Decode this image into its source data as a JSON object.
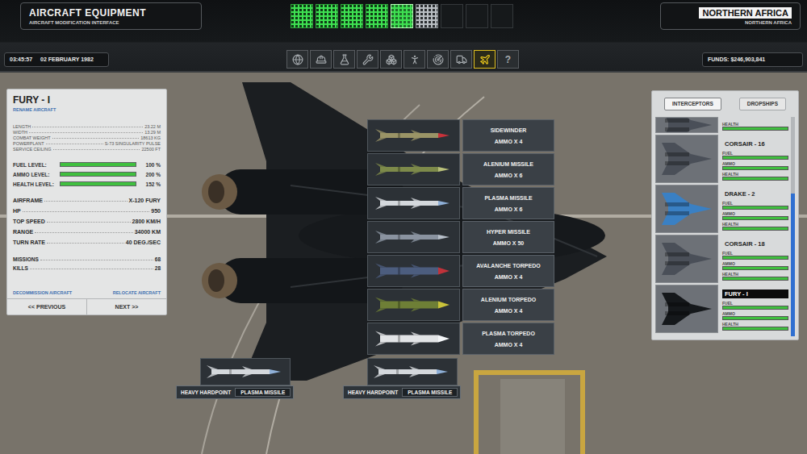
{
  "header": {
    "title": "AIRCRAFT EQUIPMENT",
    "subtitle": "AIRCRAFT MODIFICATION INTERFACE",
    "region_title": "NORTHERN AFRICA",
    "region_subtitle": "NORTHERN AFRICA",
    "time": "03:45:57",
    "date": "02 FEBRUARY 1982",
    "funds": "FUNDS: $246,903,841"
  },
  "speed_slots": [
    {
      "kind": "lit",
      "selected": false
    },
    {
      "kind": "lit",
      "selected": false
    },
    {
      "kind": "lit",
      "selected": false
    },
    {
      "kind": "lit",
      "selected": false
    },
    {
      "kind": "lit",
      "selected": true
    },
    {
      "kind": "dim",
      "selected": false
    },
    {
      "kind": "empty",
      "selected": false
    },
    {
      "kind": "empty",
      "selected": false
    },
    {
      "kind": "empty",
      "selected": false
    }
  ],
  "toolbar": [
    {
      "selected": false
    },
    {
      "selected": false
    },
    {
      "selected": false
    },
    {
      "selected": false
    },
    {
      "selected": false
    },
    {
      "selected": false
    },
    {
      "selected": false
    },
    {
      "selected": false
    },
    {
      "selected": true
    },
    {
      "glyph": "?",
      "selected": false
    }
  ],
  "aircraft": {
    "name": "FURY - I",
    "rename": "RENAME AIRCRAFT",
    "specs": [
      {
        "label": "LENGTH",
        "value": "23.22 M"
      },
      {
        "label": "WIDTH",
        "value": "13.29 M"
      },
      {
        "label": "COMBAT WEIGHT",
        "value": "18613 KG"
      },
      {
        "label": "POWERPLANT",
        "value": "S-73 SINGULARITY PULSE"
      },
      {
        "label": "SERVICE CEILING",
        "value": "22500 FT"
      }
    ],
    "levels": [
      {
        "label": "FUEL LEVEL:",
        "reading": "100 %",
        "level": 1
      },
      {
        "label": "AMMO LEVEL:",
        "reading": "200 %",
        "level": 1
      },
      {
        "label": "HEALTH LEVEL:",
        "reading": "152 %",
        "level": 1
      }
    ],
    "stats": [
      {
        "label": "AIRFRAME",
        "value": "X-120 FURY"
      },
      {
        "label": "HP",
        "value": "950"
      },
      {
        "label": "TOP SPEED",
        "value": "2800 KM/H"
      },
      {
        "label": "RANGE",
        "value": "34000 KM"
      },
      {
        "label": "TURN RATE",
        "value": "40 DEG./SEC"
      }
    ],
    "record": [
      {
        "label": "MISSIONS",
        "value": "68"
      },
      {
        "label": "KILLS",
        "value": "28"
      }
    ],
    "actions": [
      "DECOMMISSION AIRCRAFT",
      "RELOCATE AIRCRAFT"
    ],
    "nav": [
      "<< PREVIOUS",
      "NEXT >>"
    ]
  },
  "weapons": [
    {
      "name": "SIDEWINDER",
      "ammo": "AMMO X 4",
      "kind": "missile",
      "color": "#9a9466",
      "tip_color": "#c8323a"
    },
    {
      "name": "ALENIUM MISSILE",
      "ammo": "AMMO X 6",
      "kind": "missile",
      "color": "#7d8a4a",
      "tip_color": "#b9c07a"
    },
    {
      "name": "PLASMA MISSILE",
      "ammo": "AMMO X 6",
      "kind": "missile",
      "color": "#d4d8dc",
      "tip_color": "#8fb0d8"
    },
    {
      "name": "HYPER MISSILE",
      "ammo": "AMMO X 50",
      "kind": "missile",
      "color": "#8a93a0",
      "tip_color": "#b8c0ca"
    },
    {
      "name": "AVALANCHE TORPEDO",
      "ammo": "AMMO X 4",
      "kind": "torpedo",
      "color": "#4c5d7e",
      "tip_color": "#c0323a"
    },
    {
      "name": "ALENIUM TORPEDO",
      "ammo": "AMMO X 4",
      "kind": "torpedo",
      "color": "#6e7f36",
      "tip_color": "#c9c23a"
    },
    {
      "name": "PLASMA TORPEDO",
      "ammo": "AMMO X 4",
      "kind": "torpedo",
      "color": "#e2e4e6",
      "tip_color": "#f4f6f8"
    }
  ],
  "hardpoints": [
    {
      "label": "HEAVY HARDPOINT",
      "weapon": "PLASMA MISSILE",
      "color": "#d4d8dc",
      "tip_color": "#8fb0d8"
    },
    {
      "label": "HEAVY HARDPOINT",
      "weapon": "PLASMA MISSILE",
      "color": "#d4d8dc",
      "tip_color": "#8fb0d8"
    }
  ],
  "hangar": {
    "tabs": [
      {
        "label": "INTERCEPTORS",
        "selected": true
      },
      {
        "label": "DROPSHIPS",
        "selected": false
      }
    ],
    "scroll_level": 1,
    "craft": [
      {
        "kind": "partial",
        "name": "",
        "selected": false,
        "color": "#4a4f58",
        "bars": [
          {
            "label": "HEALTH",
            "level": 1
          }
        ]
      },
      {
        "kind": "full",
        "name": "CORSAIR - 16",
        "selected": false,
        "color": "#4a4f58",
        "bars": [
          {
            "label": "FUEL",
            "level": 1
          },
          {
            "label": "AMMO",
            "level": 1
          },
          {
            "label": "HEALTH",
            "level": 1
          }
        ]
      },
      {
        "kind": "full",
        "name": "DRAKE - 2",
        "selected": false,
        "color": "#3a80c4",
        "bars": [
          {
            "label": "FUEL",
            "level": 1
          },
          {
            "label": "AMMO",
            "level": 1
          },
          {
            "label": "HEALTH",
            "level": 1
          }
        ]
      },
      {
        "kind": "full",
        "name": "CORSAIR - 18",
        "selected": false,
        "color": "#4a4f58",
        "bars": [
          {
            "label": "FUEL",
            "level": 1
          },
          {
            "label": "AMMO",
            "level": 1
          },
          {
            "label": "HEALTH",
            "level": 1
          }
        ]
      },
      {
        "kind": "full",
        "name": "FURY - I",
        "selected": true,
        "color": "#15181b",
        "bars": [
          {
            "label": "FUEL",
            "level": 1
          },
          {
            "label": "AMMO",
            "level": 1
          },
          {
            "label": "HEALTH",
            "level": 1
          }
        ]
      }
    ]
  }
}
